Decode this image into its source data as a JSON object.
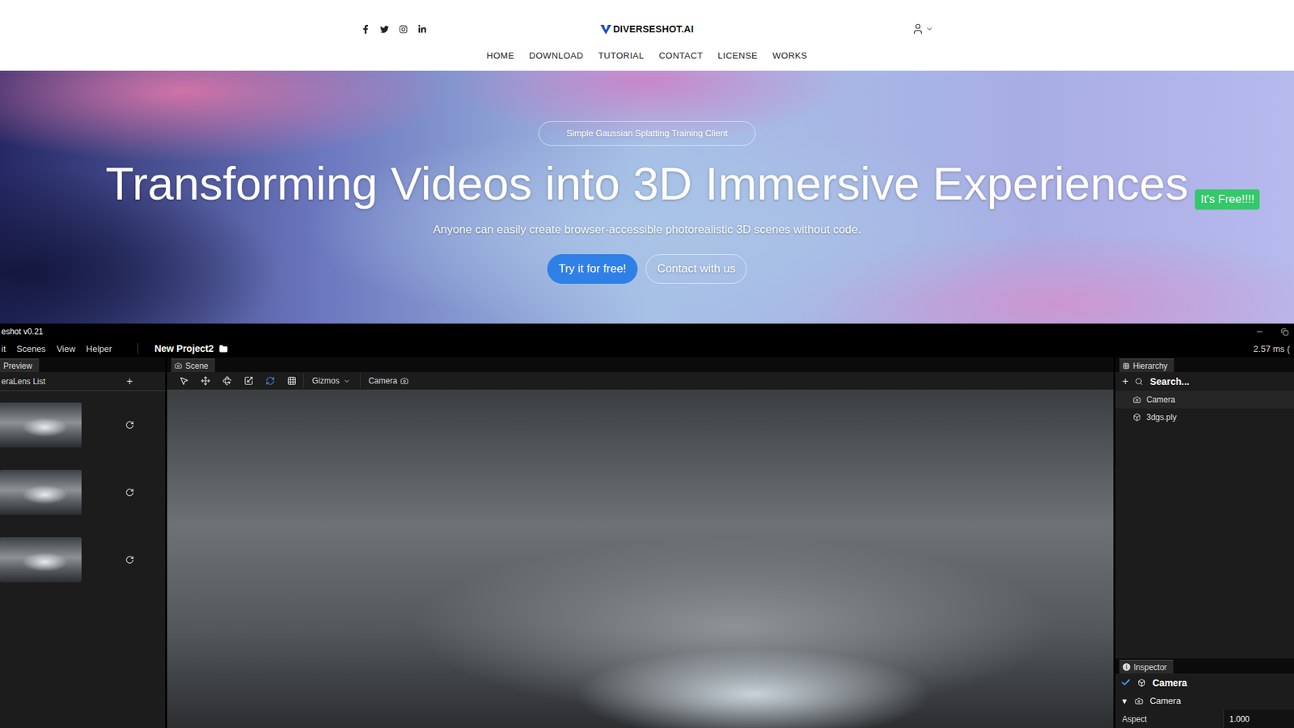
{
  "header": {
    "logo": "DIVERSESHOT.AI",
    "nav": [
      "HOME",
      "DOWNLOAD",
      "TUTORIAL",
      "CONTACT",
      "LICENSE",
      "WORKS"
    ]
  },
  "hero": {
    "badge": "Simple Gaussian Splatting Training Client",
    "title": "Transforming Videos into 3D Immersive Experiences",
    "free_badge": "It's Free!!!!",
    "subtitle": "Anyone can easily create browser-accessible photorealistic 3D scenes without code.",
    "buttons": [
      {
        "label": "Try it for free!",
        "kind": "primary"
      },
      {
        "label": "Contact with us",
        "kind": "outline"
      }
    ]
  },
  "app": {
    "title": "eshot v0.21",
    "menu": [
      "it",
      "Scenes",
      "View",
      "Helper"
    ],
    "project": "New Project2",
    "timing": "2.57 ms (",
    "preview": {
      "tab": "Preview",
      "list_title": "eraLens List",
      "add": "+",
      "items": [
        {},
        {},
        {}
      ]
    },
    "scene": {
      "tab": "Scene",
      "tools": [
        {
          "kind": "select",
          "selected": false
        },
        {
          "kind": "move",
          "selected": false
        },
        {
          "kind": "rotate",
          "selected": false
        },
        {
          "kind": "scale",
          "selected": false
        },
        {
          "kind": "local",
          "selected": true
        },
        {
          "kind": "grid",
          "selected": false
        }
      ],
      "gizmos": "Gizmos",
      "camera": "Camera"
    },
    "hierarchy": {
      "tab": "Hierarchy",
      "add": "+",
      "search": "Search...",
      "items": [
        {
          "label": "Camera",
          "kind": "camera",
          "selected": true
        },
        {
          "label": "3dgs.ply",
          "kind": "mesh",
          "selected": false
        }
      ]
    },
    "inspector": {
      "tab": "Inspector",
      "object": {
        "name": "Camera",
        "enabled": true
      },
      "component": {
        "name": "Camera",
        "toggle": "▼",
        "expanded": true
      },
      "fields": [
        {
          "label": "Aspect",
          "value": "1.000"
        }
      ]
    }
  }
}
